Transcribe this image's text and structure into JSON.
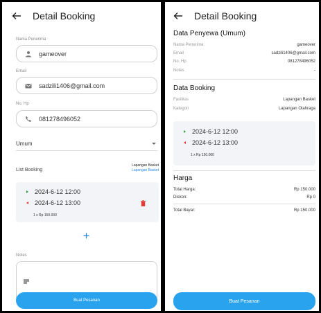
{
  "left": {
    "title": "Detail Booking",
    "recipient_label": "Nama Penerima",
    "recipient_value": "gameover",
    "email_label": "Email",
    "email_value": "sadzili1406@gmail.com",
    "phone_label": "No. Hp",
    "phone_value": "081278496052",
    "category_value": "Umum",
    "list_title": "List Booking",
    "list_facility": "Lapangan Basket",
    "list_facility_link": "Lapangan Basket",
    "start_time": "2024-6-12 12:00",
    "end_time": "2024-6-12 13:00",
    "qty_price": "1 x Rp 150.000",
    "notes_label": "Notes",
    "button_label": "Buat Pesanan"
  },
  "right": {
    "title": "Detail Booking",
    "renter_title": "Data Penyewa (Umum)",
    "renter_rows": [
      {
        "label": "Nama Penerima",
        "value": "gameover"
      },
      {
        "label": "Email",
        "value": "sadzili1406@gmail.com"
      },
      {
        "label": "No. Hp",
        "value": "081278496052"
      },
      {
        "label": "Notes",
        "value": "-"
      }
    ],
    "booking_title": "Data Booking",
    "booking_rows": [
      {
        "label": "Fasilitas",
        "value": "Lapangan Basket"
      },
      {
        "label": "Kategori",
        "value": "Lapangan Olahraga"
      }
    ],
    "start_time": "2024-6-12 12:00",
    "end_time": "2024-6-12 13:00",
    "qty_price": "1 x Rp 150.000",
    "price_title": "Harga",
    "total_label": "Total Harga:",
    "total_value": "Rp 150.000",
    "discount_label": "Diskon:",
    "discount_value": "Rp 0",
    "pay_label": "Total Bayar:",
    "pay_value": "Rp 150.000",
    "button_label": "Buat Pesanan"
  },
  "colors": {
    "accent": "#29a3ee",
    "link": "#1e88e5",
    "start_marker": "#2e9e3f",
    "end_marker": "#e53935"
  }
}
